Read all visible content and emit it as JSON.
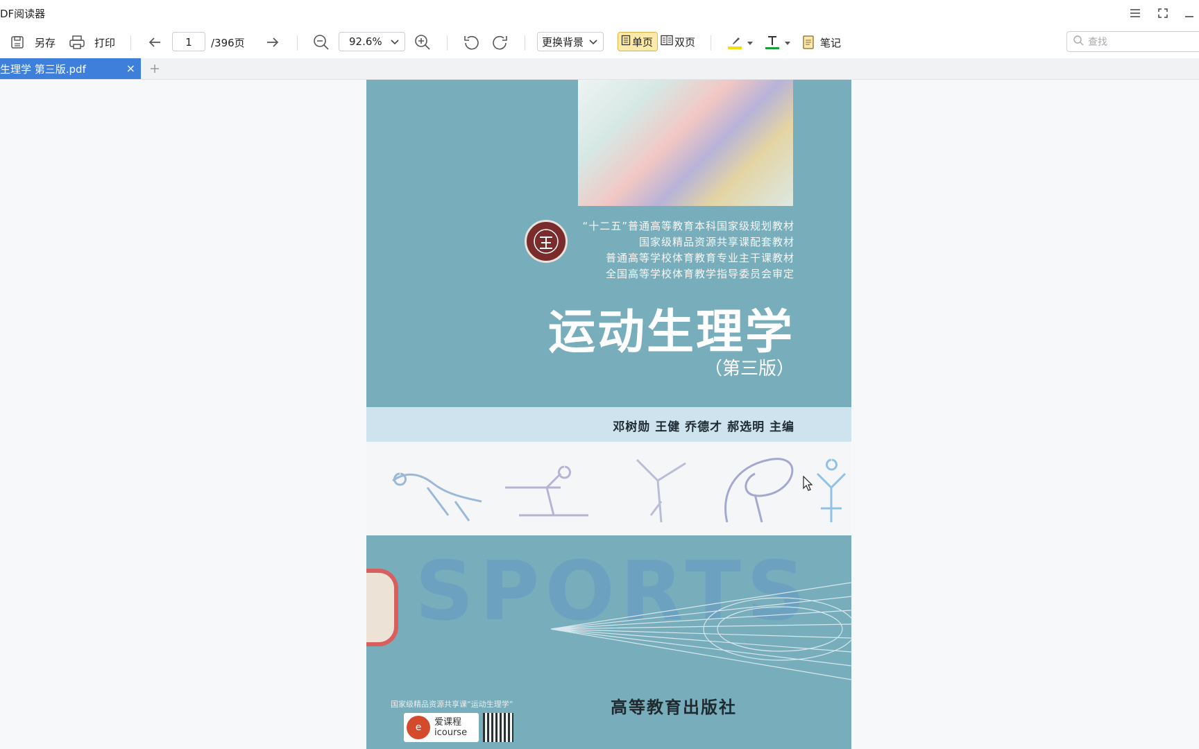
{
  "app": {
    "title": "DF阅读器"
  },
  "window_controls": {
    "menu_icon": "☰",
    "fullscreen_icon": "⛶",
    "minimize_icon": "—"
  },
  "toolbar": {
    "save_as_label": "另存",
    "print_label": "打印",
    "page_current": "1",
    "page_total": "/396页",
    "zoom_value": "92.6%",
    "background_label": "更换背景",
    "single_page_label": "单页",
    "double_page_label": "双页",
    "notes_label": "笔记",
    "highlight_color": "#f5e000",
    "text_color": "#1a9e3a"
  },
  "search": {
    "placeholder": "查找"
  },
  "tabs": [
    {
      "label": "生理学 第三版.pdf",
      "active": true
    }
  ],
  "document": {
    "series_lines": [
      "“十二五”普通高等教育本科国家级规划教材",
      "国家级精品资源共享课配套教材",
      "普通高等学校体育教育专业主干课教材",
      "全国高等学校体育教学指导委员会审定"
    ],
    "title": "运动生理学",
    "edition": "（第三版）",
    "authors": "邓树勋  王健  乔德才  郝选明  主编",
    "sports_word": "SPORTS",
    "course_note": "国家级精品资源共享课“运动生理学”",
    "icourse_cn": "爱课程",
    "icourse_en": "icourse",
    "publisher": "高等教育出版社"
  }
}
